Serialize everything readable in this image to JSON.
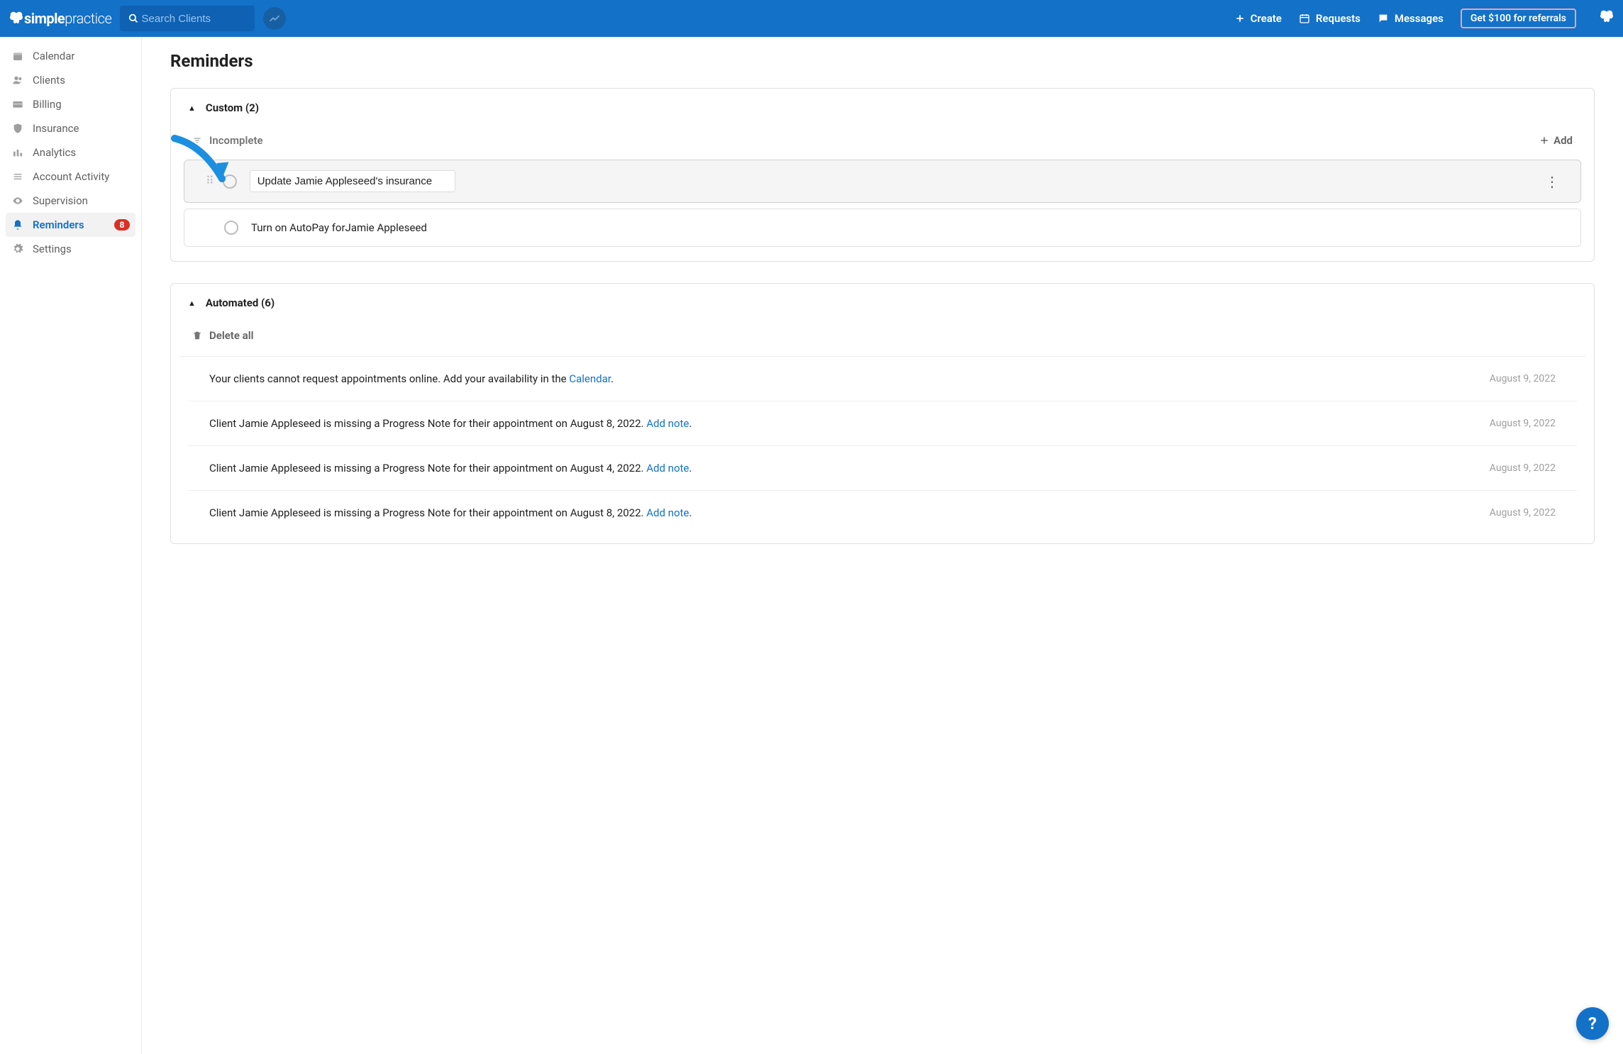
{
  "header": {
    "logo_bold": "simple",
    "logo_light": "practice",
    "search_placeholder": "Search Clients",
    "create": "Create",
    "requests": "Requests",
    "messages": "Messages",
    "referral": "Get $100 for referrals"
  },
  "sidebar": {
    "items": [
      {
        "label": "Calendar"
      },
      {
        "label": "Clients"
      },
      {
        "label": "Billing"
      },
      {
        "label": "Insurance"
      },
      {
        "label": "Analytics"
      },
      {
        "label": "Account Activity"
      },
      {
        "label": "Supervision"
      },
      {
        "label": "Reminders",
        "active": true,
        "badge": "8"
      },
      {
        "label": "Settings"
      }
    ]
  },
  "page": {
    "title": "Reminders",
    "custom": {
      "heading": "Custom (2)",
      "filter_label": "Incomplete",
      "add_label": "Add",
      "items": [
        {
          "text": "Update Jamie Appleseed's insurance",
          "editing": true
        },
        {
          "text": "Turn on AutoPay forJamie Appleseed",
          "editing": false
        }
      ]
    },
    "automated": {
      "heading": "Automated (6)",
      "delete_all": "Delete all",
      "items": [
        {
          "text": "Your clients cannot request appointments online. Add your availability in the ",
          "link": "Calendar",
          "after": ".",
          "date": "August 9, 2022"
        },
        {
          "text": "Client Jamie Appleseed is missing a Progress Note for their appointment on August 8, 2022. ",
          "link": "Add note",
          "after": ".",
          "date": "August 9, 2022"
        },
        {
          "text": "Client Jamie Appleseed is missing a Progress Note for their appointment on August 4, 2022. ",
          "link": "Add note",
          "after": ".",
          "date": "August 9, 2022"
        },
        {
          "text": "Client Jamie Appleseed is missing a Progress Note for their appointment on August 8, 2022. ",
          "link": "Add note",
          "after": ".",
          "date": "August 9, 2022"
        }
      ]
    }
  }
}
